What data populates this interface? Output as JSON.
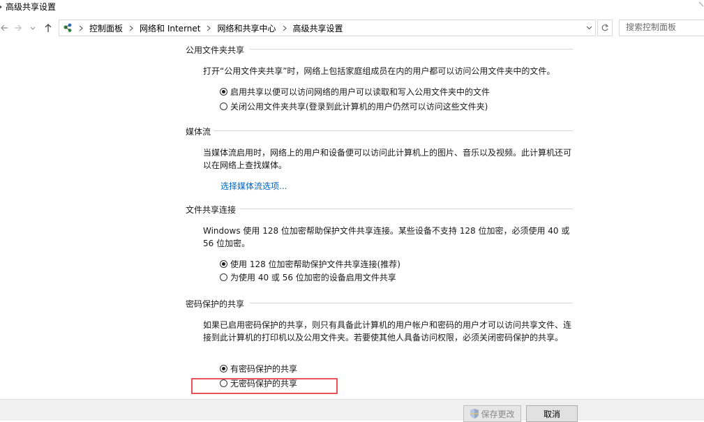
{
  "window": {
    "title": "高级共享设置"
  },
  "address_bar": {
    "crumbs": [
      "控制面板",
      "网络和 Internet",
      "网络和共享中心",
      "高级共享设置"
    ]
  },
  "search": {
    "placeholder": "搜索控制面板"
  },
  "sections": {
    "public_folder": {
      "title": "公用文件夹共享",
      "description": "打开“公用文件夹共享”时，网络上包括家庭组成员在内的用户都可以访问公用文件夹中的文件。",
      "options": [
        {
          "label": "启用共享以便可以访问网络的用户可以读取和写入公用文件夹中的文件",
          "checked": true
        },
        {
          "label": "关闭公用文件夹共享(登录到此计算机的用户仍然可以访问这些文件夹)",
          "checked": false
        }
      ]
    },
    "media_streaming": {
      "title": "媒体流",
      "description": "当媒体流启用时，网络上的用户和设备便可以访问此计算机上的图片、音乐以及视频。此计算机还可以在网络上查找媒体。",
      "link": "选择媒体流选项..."
    },
    "file_sharing": {
      "title": "文件共享连接",
      "description": "Windows 使用 128 位加密帮助保护文件共享连接。某些设备不支持 128 位加密，必须使用 40 或 56 位加密。",
      "options": [
        {
          "label": "使用 128 位加密帮助保护文件共享连接(推荐)",
          "checked": true
        },
        {
          "label": "为使用 40 或 56 位加密的设备启用文件共享",
          "checked": false
        }
      ]
    },
    "password_protected": {
      "title": "密码保护的共享",
      "description": "如果已启用密码保护的共享，则只有具备此计算机的用户帐户和密码的用户才可以访问共享文件、连接到此计算机的打印机以及公用文件夹。若要使其他人具备访问权限，必须关闭密码保护的共享。",
      "options": [
        {
          "label": "有密码保护的共享",
          "checked": true
        },
        {
          "label": "无密码保护的共享",
          "checked": false
        }
      ]
    }
  },
  "footer": {
    "save_label": "保存更改",
    "cancel_label": "取消"
  },
  "colors": {
    "link": "#0066cc",
    "highlight_box": "#e8535a"
  }
}
